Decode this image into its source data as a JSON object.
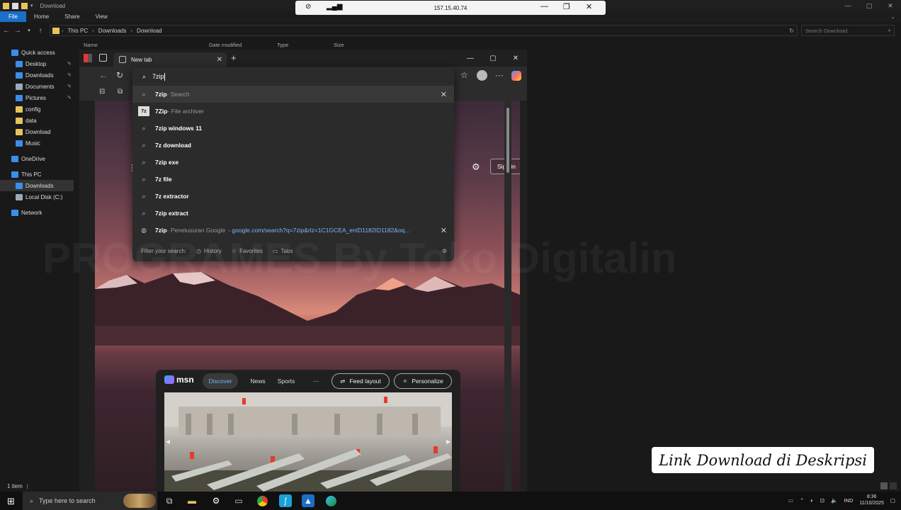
{
  "explorer": {
    "window_title": "Download",
    "ribbon_tabs": [
      "File",
      "Home",
      "Share",
      "View"
    ],
    "path": [
      "This PC",
      "Downloads",
      "Download"
    ],
    "search_placeholder": "Search Download",
    "columns": [
      "Name",
      "Date modified",
      "Type",
      "Size"
    ],
    "nav": [
      {
        "label": "Quick access",
        "icon": "star-icon",
        "color": "#3b8eea",
        "pinned": false,
        "indent": 0
      },
      {
        "label": "Desktop",
        "icon": "desktop-icon",
        "color": "#3b8eea",
        "pinned": true,
        "indent": 1
      },
      {
        "label": "Downloads",
        "icon": "download-icon",
        "color": "#3b8eea",
        "pinned": true,
        "indent": 1
      },
      {
        "label": "Documents",
        "icon": "document-icon",
        "color": "#9ab",
        "pinned": true,
        "indent": 1
      },
      {
        "label": "Pictures",
        "icon": "picture-icon",
        "color": "#3b8eea",
        "pinned": true,
        "indent": 1
      },
      {
        "label": "config",
        "icon": "folder-icon",
        "color": "#e8c55a",
        "pinned": false,
        "indent": 1
      },
      {
        "label": "data",
        "icon": "folder-icon",
        "color": "#e8c55a",
        "pinned": false,
        "indent": 1
      },
      {
        "label": "Download",
        "icon": "folder-icon",
        "color": "#e8c55a",
        "pinned": false,
        "indent": 1
      },
      {
        "label": "Music",
        "icon": "music-icon",
        "color": "#3b8eea",
        "pinned": false,
        "indent": 1
      },
      {
        "label": "",
        "icon": "",
        "color": "",
        "pinned": false,
        "indent": 0
      },
      {
        "label": "OneDrive",
        "icon": "cloud-icon",
        "color": "#3b8eea",
        "pinned": false,
        "indent": 0
      },
      {
        "label": "",
        "icon": "",
        "color": "",
        "pinned": false,
        "indent": 0
      },
      {
        "label": "This PC",
        "icon": "computer-icon",
        "color": "#3b8eea",
        "pinned": false,
        "indent": 0
      },
      {
        "label": "Downloads",
        "icon": "download-icon",
        "color": "#3b8eea",
        "pinned": false,
        "indent": 1,
        "selected": true
      },
      {
        "label": "Local Disk (C:)",
        "icon": "disk-icon",
        "color": "#9ab",
        "pinned": false,
        "indent": 1
      },
      {
        "label": "",
        "icon": "",
        "color": "",
        "pinned": false,
        "indent": 0
      },
      {
        "label": "Network",
        "icon": "network-icon",
        "color": "#3b8eea",
        "pinned": false,
        "indent": 0
      }
    ],
    "status": "1 item"
  },
  "remote": {
    "ip": "157.15.40.74"
  },
  "edge": {
    "tab_title": "New tab",
    "address_value": "7zip",
    "sign_in": "Sign in",
    "suggestions": [
      {
        "bold": "7zip",
        "sub": " - Search",
        "icon": "search-icon",
        "highlight": true,
        "remove": true
      },
      {
        "bold": "7Zip",
        "sub": " - File archiver",
        "icon": "7zip-icon"
      },
      {
        "bold": "7zip windows 11",
        "sub": "",
        "icon": "search-icon"
      },
      {
        "bold": "7z download",
        "sub": "",
        "icon": "search-icon"
      },
      {
        "bold": "7zip exe",
        "sub": "",
        "icon": "search-icon"
      },
      {
        "bold": "7z file",
        "sub": "",
        "icon": "search-icon"
      },
      {
        "bold": "7z extractor",
        "sub": "",
        "icon": "search-icon"
      },
      {
        "bold": "7zip extract",
        "sub": "",
        "icon": "search-icon"
      },
      {
        "bold": "7zip",
        "sub": " - Penelusuran Google",
        "url": " - google.com/search?q=7zip&rlz=1C1GCEA_enID1182ID1182&oq...",
        "icon": "globe-icon",
        "remove": true
      }
    ],
    "footer": {
      "label": "Filter your search:",
      "history": "History",
      "favorites": "Favorites",
      "tabs": "Tabs"
    },
    "msn": {
      "logo": "msn",
      "tabs": [
        "Discover",
        "News",
        "Sports"
      ],
      "more": "···",
      "feed_layout": "Feed layout",
      "personalize": "Personalize"
    }
  },
  "banner": "Link Download di Deskripsi",
  "watermark": "PROGRAMES By Toko Digitalin",
  "taskbar": {
    "search": "Type here to search",
    "lang": "IND",
    "time": "8:36",
    "date": "11/10/2025"
  }
}
